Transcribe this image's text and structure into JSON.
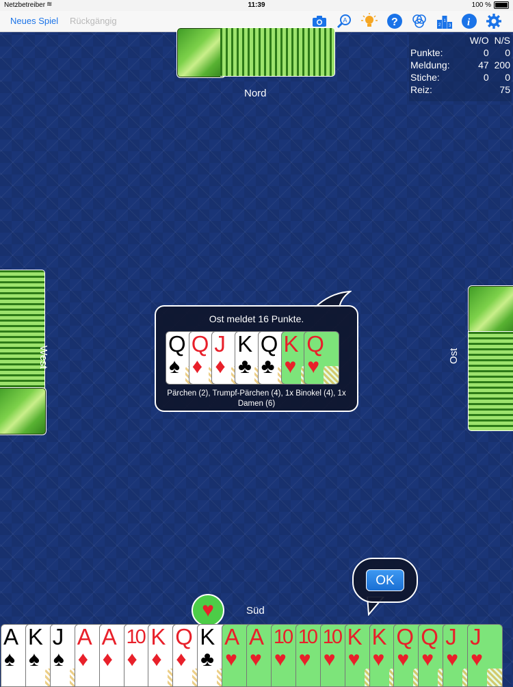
{
  "status": {
    "carrier": "Netzbetreiber",
    "time": "11:39",
    "battery": "100 %"
  },
  "toolbar": {
    "new_game": "Neues Spiel",
    "undo": "Rückgängig",
    "icons": [
      "camera-icon",
      "search-hint-icon",
      "lightbulb-icon",
      "help-icon",
      "circles-icon",
      "ranking-icon",
      "info-icon",
      "gear-icon"
    ]
  },
  "scoreboard": {
    "headers": [
      "",
      "W/O",
      "N/S"
    ],
    "rows": [
      {
        "label": "Punkte:",
        "wo": "0",
        "ns": "0"
      },
      {
        "label": "Meldung:",
        "wo": "47",
        "ns": "200"
      },
      {
        "label": "Stiche:",
        "wo": "0",
        "ns": "0"
      },
      {
        "label": "Reiz:",
        "wo": "",
        "ns": "75"
      }
    ]
  },
  "players": {
    "north": "Nord",
    "west": "West",
    "east": "Ost",
    "south": "Süd"
  },
  "meld": {
    "title": "Ost meldet 16 Punkte.",
    "cards": [
      {
        "rank": "Q",
        "suit": "♠",
        "color": "black",
        "green": false
      },
      {
        "rank": "Q",
        "suit": "♦",
        "color": "red",
        "green": false
      },
      {
        "rank": "J",
        "suit": "♦",
        "color": "red",
        "green": false
      },
      {
        "rank": "K",
        "suit": "♣",
        "color": "black",
        "green": false
      },
      {
        "rank": "Q",
        "suit": "♣",
        "color": "black",
        "green": false
      },
      {
        "rank": "K",
        "suit": "♥",
        "color": "red",
        "green": true
      },
      {
        "rank": "Q",
        "suit": "♥",
        "color": "red",
        "green": true
      }
    ],
    "description": "Pärchen (2), Trumpf-Pärchen (4), 1x Binokel (4), 1x Damen (6)"
  },
  "ok_label": "OK",
  "trump_suit": "♥",
  "hand": [
    {
      "rank": "A",
      "suit": "♠",
      "color": "black",
      "green": false
    },
    {
      "rank": "K",
      "suit": "♠",
      "color": "black",
      "green": false
    },
    {
      "rank": "J",
      "suit": "♠",
      "color": "black",
      "green": false
    },
    {
      "rank": "A",
      "suit": "♦",
      "color": "red",
      "green": false
    },
    {
      "rank": "A",
      "suit": "♦",
      "color": "red",
      "green": false
    },
    {
      "rank": "10",
      "suit": "♦",
      "color": "red",
      "green": false
    },
    {
      "rank": "K",
      "suit": "♦",
      "color": "red",
      "green": false
    },
    {
      "rank": "Q",
      "suit": "♦",
      "color": "red",
      "green": false
    },
    {
      "rank": "K",
      "suit": "♣",
      "color": "black",
      "green": false
    },
    {
      "rank": "A",
      "suit": "♥",
      "color": "red",
      "green": true
    },
    {
      "rank": "A",
      "suit": "♥",
      "color": "red",
      "green": true
    },
    {
      "rank": "10",
      "suit": "♥",
      "color": "red",
      "green": true
    },
    {
      "rank": "10",
      "suit": "♥",
      "color": "red",
      "green": true
    },
    {
      "rank": "10",
      "suit": "♥",
      "color": "red",
      "green": true
    },
    {
      "rank": "K",
      "suit": "♥",
      "color": "red",
      "green": true
    },
    {
      "rank": "K",
      "suit": "♥",
      "color": "red",
      "green": true
    },
    {
      "rank": "Q",
      "suit": "♥",
      "color": "red",
      "green": true
    },
    {
      "rank": "Q",
      "suit": "♥",
      "color": "red",
      "green": true
    },
    {
      "rank": "J",
      "suit": "♥",
      "color": "red",
      "green": true
    },
    {
      "rank": "J",
      "suit": "♥",
      "color": "red",
      "green": true
    }
  ],
  "colors": {
    "felt": "#1a3577",
    "accent": "#1a73e8",
    "trump_green": "#4ccd47",
    "card_green": "#7de47a"
  }
}
